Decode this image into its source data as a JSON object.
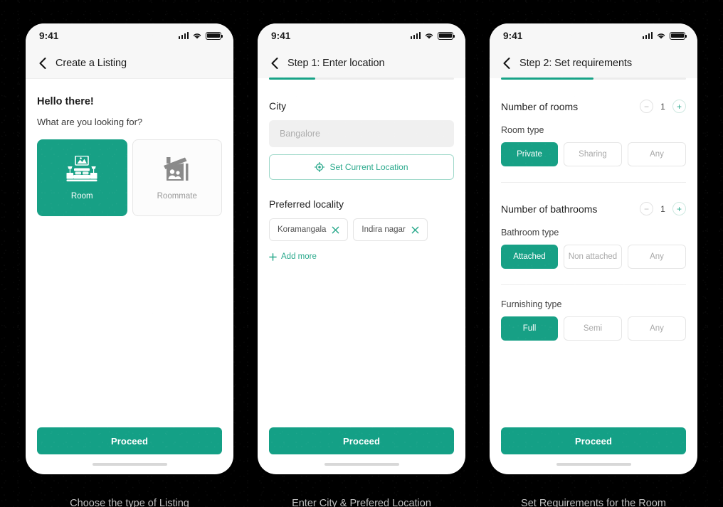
{
  "status_bar": {
    "time": "9:41"
  },
  "screens": [
    {
      "nav_title": "Create a Listing",
      "progress": null,
      "greeting": "Hello there!",
      "question": "What are you looking for?",
      "type_cards": [
        {
          "label": "Room",
          "icon": "bedroom-icon",
          "selected": true
        },
        {
          "label": "Roommate",
          "icon": "house-people-icon",
          "selected": false
        }
      ],
      "cta": "Proceed",
      "caption": "Choose the type of Listing"
    },
    {
      "nav_title": "Step 1: Enter location",
      "progress": "25%",
      "city_label": "City",
      "city_value": "",
      "city_placeholder": "Bangalore",
      "set_location_label": "Set Current Location",
      "locality_label": "Preferred locality",
      "localities": [
        "Koramangala",
        "Indira nagar"
      ],
      "add_more_label": "Add more",
      "cta": "Proceed",
      "caption": "Enter City & Prefered Location"
    },
    {
      "nav_title": "Step 2: Set requirements",
      "progress": "50%",
      "rooms_label": "Number of rooms",
      "rooms_value": "1",
      "room_type_label": "Room type",
      "room_type_options": [
        {
          "label": "Private",
          "active": true
        },
        {
          "label": "Sharing",
          "active": false
        },
        {
          "label": "Any",
          "active": false
        }
      ],
      "bathrooms_label": "Number of bathrooms",
      "bathrooms_value": "1",
      "bathroom_type_label": "Bathroom type",
      "bathroom_type_options": [
        {
          "label": "Attached",
          "active": true
        },
        {
          "label": "Non attached",
          "active": false
        },
        {
          "label": "Any",
          "active": false
        }
      ],
      "furnishing_label": "Furnishing type",
      "furnishing_options": [
        {
          "label": "Full",
          "active": true
        },
        {
          "label": "Semi",
          "active": false
        },
        {
          "label": "Any",
          "active": false
        }
      ],
      "cta": "Proceed",
      "caption": "Set Requirements for the Room"
    }
  ],
  "colors": {
    "brand_green": "#17A085",
    "button_green": "#14A086",
    "accent_text": "#2aa98c",
    "backdrop": "#000000"
  }
}
